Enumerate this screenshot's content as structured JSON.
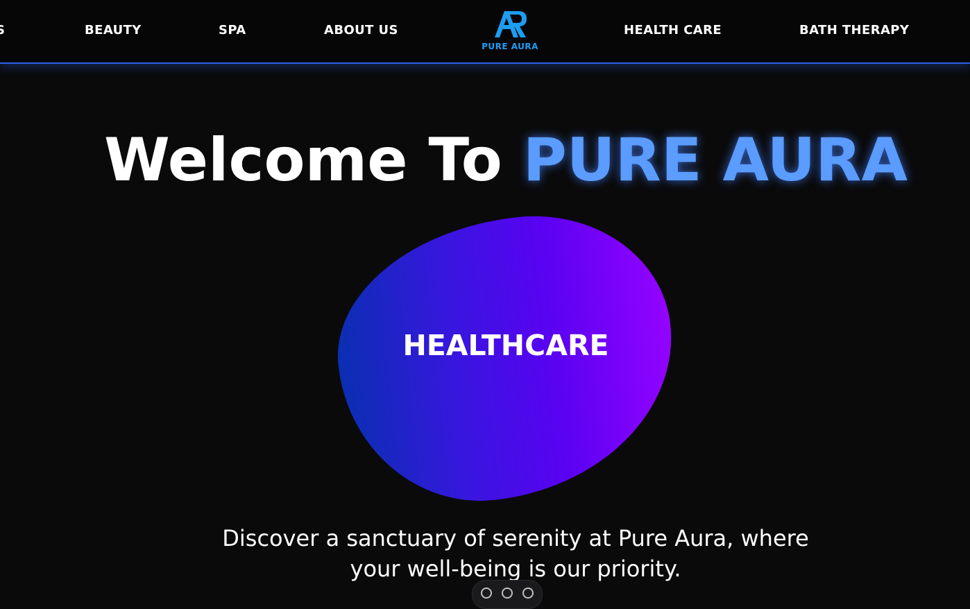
{
  "nav": {
    "items": [
      {
        "label": "S"
      },
      {
        "label": "BEAUTY"
      },
      {
        "label": "SPA"
      },
      {
        "label": "ABOUT US"
      },
      {
        "label": "HEALTH CARE"
      },
      {
        "label": "BATH THERAPY"
      }
    ],
    "logo_text": "PURE AURA",
    "logo_color": "#1e9cf0",
    "border_color": "#2f5fe8"
  },
  "hero": {
    "title_prefix": "Welcome To",
    "title_brand": "PURE AURA",
    "brand_color": "#5a9cff",
    "blob_label": "HEALTHCARE",
    "tagline_line1": "Discover a sanctuary of serenity at Pure Aura, where",
    "tagline_line2": "your well-being is our priority."
  },
  "colors": {
    "background": "#0a0a0b",
    "gradient_start": "#0a2fb2",
    "gradient_end": "#9403ff"
  }
}
